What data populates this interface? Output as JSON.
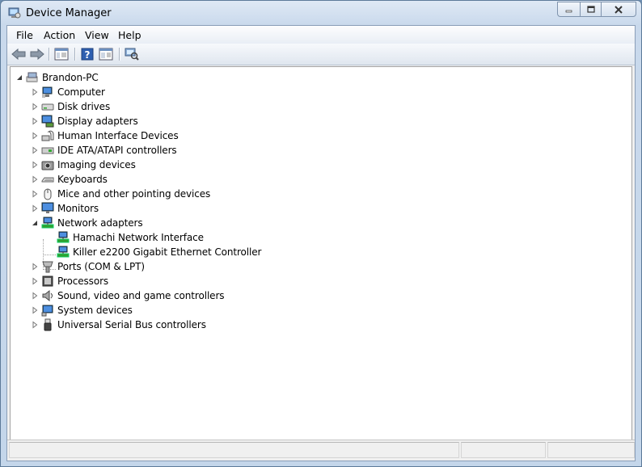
{
  "window": {
    "title": "Device Manager"
  },
  "menu": [
    "File",
    "Action",
    "View",
    "Help"
  ],
  "toolbar": {
    "back_icon": "back-arrow-icon",
    "forward_icon": "forward-arrow-icon",
    "show_hide_icon": "console-tree-icon",
    "help_icon": "help-icon",
    "properties_icon": "properties-icon",
    "scan_icon": "scan-hardware-icon"
  },
  "tree": {
    "root": {
      "label": "Brandon-PC",
      "icon": "computer-icon",
      "expanded": true
    },
    "categories": [
      {
        "label": "Computer",
        "icon": "computer-icon",
        "expanded": false
      },
      {
        "label": "Disk drives",
        "icon": "disk-drive-icon",
        "expanded": false
      },
      {
        "label": "Display adapters",
        "icon": "display-adapter-icon",
        "expanded": false
      },
      {
        "label": "Human Interface Devices",
        "icon": "hid-icon",
        "expanded": false
      },
      {
        "label": "IDE ATA/ATAPI controllers",
        "icon": "ide-controller-icon",
        "expanded": false
      },
      {
        "label": "Imaging devices",
        "icon": "camera-icon",
        "expanded": false
      },
      {
        "label": "Keyboards",
        "icon": "keyboard-icon",
        "expanded": false
      },
      {
        "label": "Mice and other pointing devices",
        "icon": "mouse-icon",
        "expanded": false
      },
      {
        "label": "Monitors",
        "icon": "monitor-icon",
        "expanded": false
      },
      {
        "label": "Network adapters",
        "icon": "network-adapter-icon",
        "expanded": true,
        "children": [
          {
            "label": "Hamachi Network Interface",
            "icon": "network-adapter-icon"
          },
          {
            "label": "Killer e2200 Gigabit Ethernet Controller",
            "icon": "network-adapter-icon"
          }
        ]
      },
      {
        "label": "Ports (COM & LPT)",
        "icon": "port-icon",
        "expanded": false
      },
      {
        "label": "Processors",
        "icon": "processor-icon",
        "expanded": false
      },
      {
        "label": "Sound, video and game controllers",
        "icon": "speaker-icon",
        "expanded": false
      },
      {
        "label": "System devices",
        "icon": "system-device-icon",
        "expanded": false
      },
      {
        "label": "Universal Serial Bus controllers",
        "icon": "usb-icon",
        "expanded": false
      }
    ]
  },
  "colors": {
    "accent": "#3a6ea5",
    "network_green": "#2fa12f",
    "tree_bg": "#ffffff"
  }
}
